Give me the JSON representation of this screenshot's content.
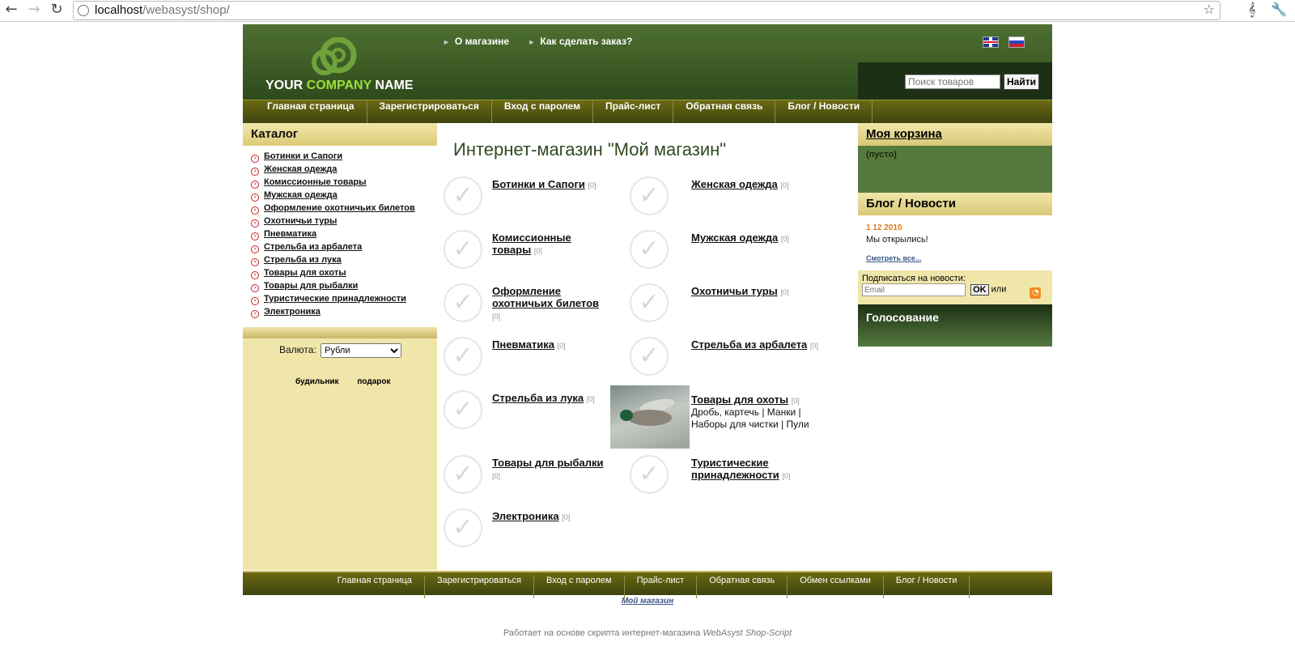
{
  "browser": {
    "url_host": "localhost",
    "url_path": "/webasyst/shop/"
  },
  "header": {
    "logo_your": "YOUR ",
    "logo_company": "COMPANY",
    "logo_name": " NAME",
    "top_links": [
      "О магазине",
      "Как сделать заказ?"
    ],
    "search_placeholder": "Поиск товаров",
    "search_button": "Найти"
  },
  "menu": [
    "Главная страница",
    "Зарегистрироваться",
    "Вход с паролем",
    "Прайс-лист",
    "Обратная связь",
    "Блог / Новости"
  ],
  "catalog": {
    "title": "Каталог",
    "items": [
      "Ботинки и Сапоги",
      "Женская одежда",
      "Комиссионные товары",
      "Мужская одежда",
      "Оформление охотничьих билетов",
      "Охотничьи туры",
      "Пневматика",
      "Стрельба из арбалета",
      "Стрельба из лука",
      "Товары для охоты",
      "Товары для рыбалки",
      "Туристические принадлежности",
      "Электроника"
    ]
  },
  "currency": {
    "label": "Валюта:",
    "selected": "Рубли"
  },
  "tags": [
    "будильник",
    "подарок"
  ],
  "main": {
    "title": "Интернет-магазин \"Мой магазин\"",
    "categories": [
      {
        "name": "Ботинки и Сапоги",
        "count": "[0]"
      },
      {
        "name": "Женская одежда",
        "count": "[0]"
      },
      {
        "name": "Комиссионные товары",
        "count": "[0]"
      },
      {
        "name": "Мужская одежда",
        "count": "[0]"
      },
      {
        "name": "Оформление охотничьих билетов",
        "count": "[0]"
      },
      {
        "name": "Охотничьи туры",
        "count": "[0]"
      },
      {
        "name": "Пневматика",
        "count": "[0]"
      },
      {
        "name": "Стрельба из арбалета",
        "count": "[0]"
      },
      {
        "name": "Стрельба из лука",
        "count": "[0]"
      },
      {
        "name": "Товары для охоты",
        "count": "[0]",
        "sub": "Дробь, картечь | Манки | Наборы для чистки | Пули"
      },
      {
        "name": "Товары для рыбалки",
        "count": "[0]"
      },
      {
        "name": "Туристические принадлежности",
        "count": "[0]"
      },
      {
        "name": "Электроника",
        "count": "[0]"
      }
    ]
  },
  "cart": {
    "title": "Моя корзина",
    "status": "(пусто)"
  },
  "blog": {
    "title": "Блог / Новости",
    "date": "1 12 2010",
    "text": "Мы открылись!",
    "more": "Смотреть все..."
  },
  "subscribe": {
    "label": "Подписаться на новости:",
    "placeholder": "Email",
    "ok": "OK",
    "or": "или"
  },
  "poll": {
    "title": "Голосование"
  },
  "footer": {
    "links": [
      "Главная страница",
      "Зарегистрироваться",
      "Вход с паролем",
      "Прайс-лист",
      "Обратная связь",
      "Обмен ссылками",
      "Блог / Новости"
    ],
    "store_name": "Мой магазин",
    "credit_prefix": "Работает на основе скрипта интернет-магазина ",
    "credit_product": "WebAsyst Shop-Script"
  },
  "colors": {
    "header_green": "#2e4b1c",
    "menu_olive": "#3e430f",
    "sidebar_cream": "#f1e6aa",
    "logo_accent": "#9de03a",
    "blog_date": "#e07a10"
  }
}
